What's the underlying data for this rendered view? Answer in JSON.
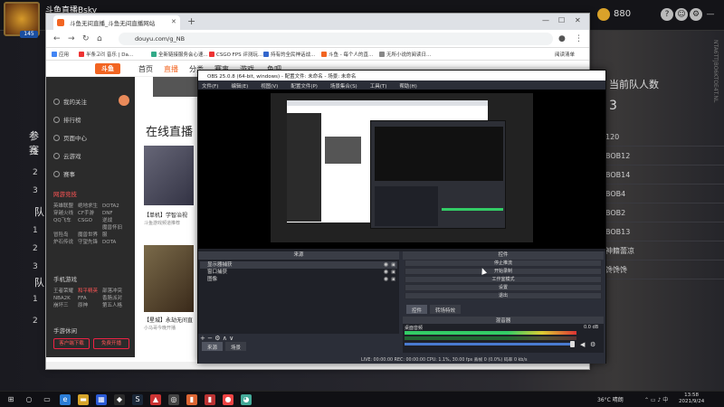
{
  "game": {
    "player_name": "斗鱼直播Bsky",
    "level": "145",
    "coins": "880",
    "left_numbers": [
      "1",
      "2",
      "3",
      "1",
      "2",
      "3",
      "1",
      "2"
    ],
    "left_labels": [
      "参赛",
      "队",
      "队"
    ],
    "right_title": "当前队人数",
    "right_big": "3",
    "ranks": [
      "120",
      "BOB12",
      "BOB14",
      "BOB4",
      "BOB2",
      "BOB13",
      "神籍蕾凉",
      "馋馋馋"
    ],
    "side_text": "NTA6TTJBO6KTOE4T.NL"
  },
  "chrome": {
    "tab_title": "斗鱼无间直播_斗鱼无间直播网站",
    "url": "douyu.com/g_NB",
    "bookmarks": [
      "应用",
      "半条고려 音乐 | Da...",
      "全新链接服务会心速...",
      "CSGO FPS 评测玩...",
      "持有的全民神话战...",
      "斗鱼 - 每个人的直...",
      "无所小说的阅读日..."
    ],
    "reading_list": "阅读清单",
    "site_logo": "斗鱼",
    "site_nav": [
      "首页",
      "直播",
      "分类",
      "赛事",
      "游戏",
      "鱼吧"
    ],
    "sidebar": {
      "items": [
        "我的关注",
        "排行榜",
        "页面中心",
        "云游戏",
        "赛事"
      ],
      "section_hot": "网游竞技",
      "hot_games": [
        "英雄联盟",
        "绝地求生",
        "DOTA2",
        "穿越火线",
        "CF手游",
        "DNF",
        "QQ飞车",
        "CSGO",
        "逆战",
        "冒险岛",
        "魔兽世界",
        "魔兽怀旧服",
        "炉石传说",
        "守望先锋",
        "DOTA"
      ],
      "section_mobile": "手机游戏",
      "mobile_games": [
        "王者荣耀",
        "和平精英",
        "部落冲突",
        "NBA2K",
        "FFA",
        "香肠派对",
        "崩坏三",
        "原神",
        "第五人格"
      ],
      "section_more": "手游休闲",
      "btn_download": "客户端下载",
      "btn_open": "免费开播"
    },
    "main": {
      "live_title": "在线直播",
      "cards": [
        {
          "caption": "【单机】学智治视",
          "sub": "斗鱼游戏频道推荐"
        },
        {
          "caption": "【星城】永劫无间直",
          "sub": "小马哥今晚开播"
        }
      ]
    }
  },
  "obs": {
    "title": "OBS 25.0.8 (64-bit, windows) - 配置文件: 未命名 - 场景: 未命名",
    "menu": [
      "文件(F)",
      "编辑(E)",
      "视图(V)",
      "配置文件(P)",
      "场景集合(S)",
      "工具(T)",
      "帮助(H)"
    ],
    "scenes_header": "来源",
    "sources": [
      "显示器捕获",
      "窗口捕获",
      "图像"
    ],
    "scene_tabs": [
      "来源",
      "场景"
    ],
    "controls_header": "控件",
    "controls": [
      "停止推流",
      "开始录制",
      "工作室模式",
      "设置",
      "退出"
    ],
    "mixer_tabs": [
      "控件",
      "转场特效"
    ],
    "mixer_header": "混音器",
    "mixer_label": "桌面音频",
    "mixer_db": "0.0 dB",
    "status": "LIVE: 00:00:00   REC: 00:00:00   CPU: 1.1%, 30.00 fps      丢帧 0 (0.0%)  码率 0 kb/s"
  },
  "taskbar": {
    "temp": "36°C  晴朗",
    "time": "13:58",
    "date": "2021/9/24"
  },
  "colors": {
    "douyu_orange": "#f26522",
    "obs_bg": "#2b2e38"
  }
}
